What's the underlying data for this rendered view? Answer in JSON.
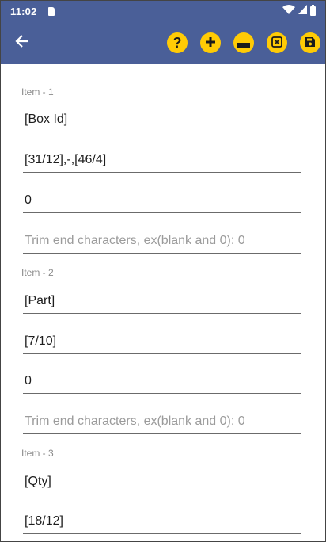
{
  "status_bar": {
    "time": "11:02",
    "icons": [
      "sd-card-icon",
      "wifi-icon",
      "signal-icon",
      "battery-icon"
    ]
  },
  "toolbar": {
    "back_icon": "arrow-left-icon",
    "buttons": [
      {
        "name": "help-button",
        "icon": "question-icon",
        "glyph": "?"
      },
      {
        "name": "add-button",
        "icon": "plus-icon",
        "glyph": "+"
      },
      {
        "name": "remove-button",
        "icon": "minus-icon",
        "glyph": "−"
      },
      {
        "name": "clear-button",
        "icon": "close-box-icon",
        "glyph": "⊠"
      },
      {
        "name": "save-button",
        "icon": "floppy-disk-icon",
        "glyph": "💾"
      }
    ],
    "colors": {
      "bar": "#4a5f98",
      "button": "#ffcb05"
    }
  },
  "items": [
    {
      "label": "Item - 1",
      "field1": "[Box Id]",
      "field2": "[31/12],-,[46/4]",
      "field3": "0",
      "trim_placeholder": "Trim end characters, ex(blank and 0): 0"
    },
    {
      "label": "Item - 2",
      "field1": "[Part]",
      "field2": "[7/10]",
      "field3": "0",
      "trim_placeholder": "Trim end characters, ex(blank and 0): 0"
    },
    {
      "label": "Item - 3",
      "field1": "[Qty]",
      "field2": "[18/12]"
    }
  ]
}
